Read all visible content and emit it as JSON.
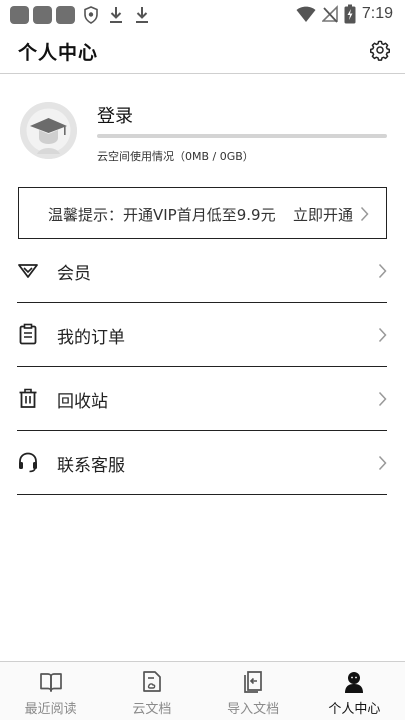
{
  "status_bar": {
    "time": "7:19"
  },
  "header": {
    "title": "个人中心"
  },
  "profile": {
    "login_label": "登录",
    "usage_text": "云空间使用情况（0MB / 0GB）",
    "usage_fraction": 0
  },
  "promo": {
    "text": "温馨提示：开通VIP首月低至9.9元",
    "action": "立即开通"
  },
  "menu": {
    "items": [
      {
        "label": "会员",
        "icon": "diamond-icon"
      },
      {
        "label": "我的订单",
        "icon": "clipboard-icon"
      },
      {
        "label": "回收站",
        "icon": "trash-icon"
      },
      {
        "label": "联系客服",
        "icon": "headset-icon"
      }
    ]
  },
  "bottom_nav": {
    "items": [
      {
        "label": "最近阅读",
        "icon": "book-icon"
      },
      {
        "label": "云文档",
        "icon": "cloud-document-icon"
      },
      {
        "label": "导入文档",
        "icon": "import-icon"
      },
      {
        "label": "个人中心",
        "icon": "person-icon"
      }
    ],
    "active": "个人中心"
  }
}
